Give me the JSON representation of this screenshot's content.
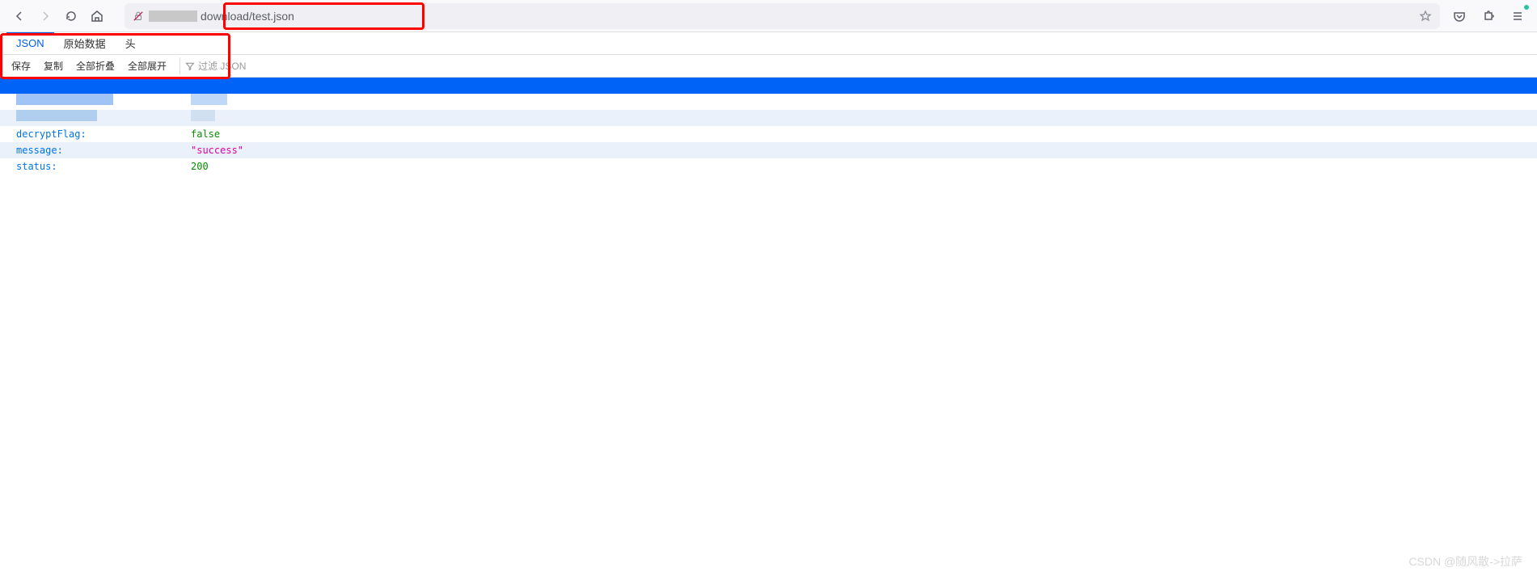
{
  "browser": {
    "url_visible": "download/test.json"
  },
  "tabs": {
    "json": "JSON",
    "raw": "原始数据",
    "headers": "头"
  },
  "actions": {
    "save": "保存",
    "copy": "复制",
    "collapse_all": "全部折叠",
    "expand_all": "全部展开",
    "filter_placeholder": "过滤 JSON"
  },
  "json": {
    "decryptFlag": {
      "key": "decryptFlag:",
      "value": "false"
    },
    "message": {
      "key": "message:",
      "value": "\"success\""
    },
    "status": {
      "key": "status:",
      "value": "200"
    }
  },
  "watermark": "CSDN @随风散->拉萨"
}
